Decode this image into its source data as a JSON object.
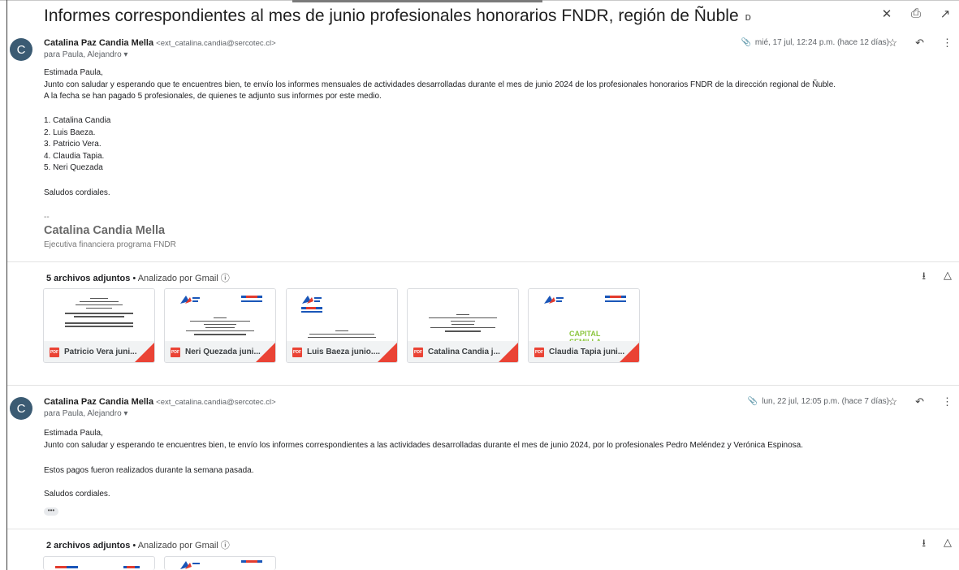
{
  "thread": {
    "subject": "Informes correspondientes al mes de junio profesionales honorarios FNDR, región de Ñuble",
    "label_icon": "label-icon",
    "actions": [
      "collapse-icon",
      "print-icon",
      "open-new-window-icon"
    ]
  },
  "messages": [
    {
      "avatar_letter": "C",
      "sender_name": "Catalina Paz Candia Mella",
      "sender_email": "<ext_catalina.candia@sercotec.cl>",
      "to": "para Paula, Alejandro ▾",
      "date": "mié, 17 jul, 12:24 p.m. (hace 12 días)",
      "body": [
        "Estimada Paula,",
        "Junto con saludar y esperando que te encuentres bien, te envío los informes mensuales de actividades desarrolladas durante el mes de junio 2024 de los profesionales honorarios FNDR de la dirección regional de Ñuble.",
        "A la fecha se han pagado 5 profesionales, de quienes te adjunto sus informes por este medio.",
        "",
        "1. Catalina Candia",
        "2. Luis Baeza.",
        "3. Patricio Vera.",
        "4. Claudia Tapia.",
        "5. Neri Quezada",
        "",
        "Saludos cordiales."
      ],
      "signature": {
        "dash": "--",
        "name": "Catalina Candia Mella",
        "title": "Ejecutiva financiera programa FNDR"
      },
      "attachments_header": {
        "count": "5 archivos adjuntos",
        "separator": "•",
        "scanned": "Analizado por Gmail ⓘ"
      },
      "attachments": [
        {
          "name": "Patricio Vera juni..."
        },
        {
          "name": "Neri Quezada juni..."
        },
        {
          "name": "Luis Baeza junio...."
        },
        {
          "name": "Catalina Candia j..."
        },
        {
          "name": "Claudia Tapia juni..."
        }
      ]
    },
    {
      "avatar_letter": "C",
      "sender_name": "Catalina Paz Candia Mella",
      "sender_email": "<ext_catalina.candia@sercotec.cl>",
      "to": "para Paula, Alejandro ▾",
      "date": "lun, 22 jul, 12:05 p.m. (hace 7 días)",
      "body": [
        "Estimada Paula,",
        "Junto con saludar y esperando te encuentres bien, te envío los informes correspondientes a las actividades desarrolladas durante el mes de junio 2024, por lo profesionales Pedro Meléndez y Verónica Espinosa.",
        "",
        "Estos pagos fueron realizados durante la semana pasada.",
        "",
        "Saludos cordiales."
      ],
      "ellipsis": "•••",
      "attachments_header": {
        "count": "2 archivos adjuntos",
        "separator": "•",
        "scanned": "Analizado por Gmail ⓘ"
      }
    }
  ],
  "preview_text": {
    "capital": "CAPITAL",
    "semilla": "SEMILLA"
  },
  "colors": {
    "avatar": "#3b5b73",
    "pdf": "#ea4335",
    "capital_green": "#8cc63f"
  }
}
